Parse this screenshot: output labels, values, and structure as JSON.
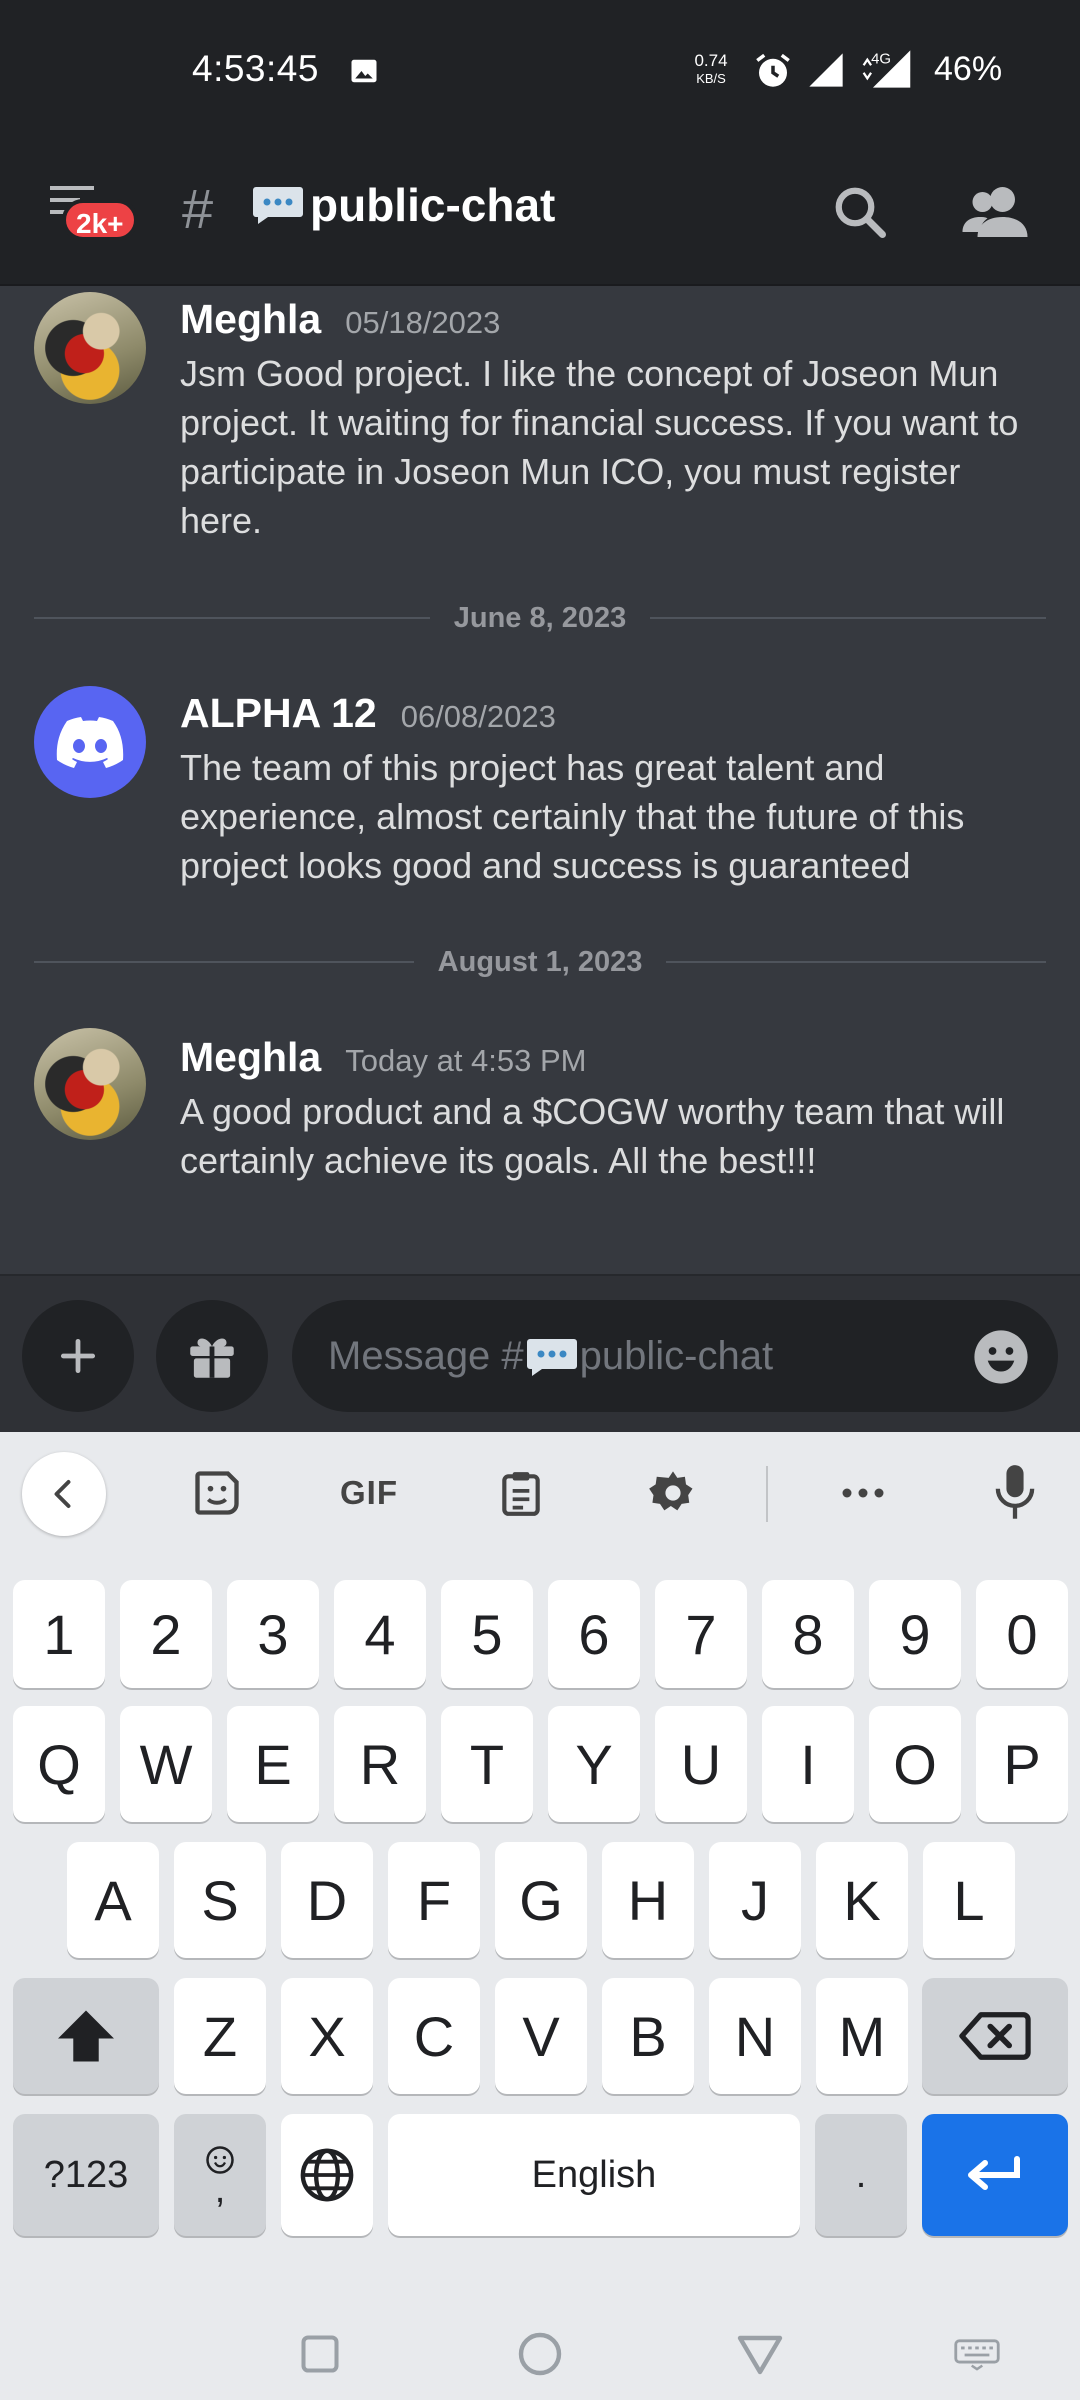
{
  "status_bar": {
    "time": "4:53:45",
    "net_speed": "0.74",
    "net_unit": "KB/S",
    "network_type": "4G",
    "battery": "46%"
  },
  "header": {
    "badge": "2k+",
    "hash": "#",
    "channel_name": "public-chat",
    "icons": [
      "menu-icon",
      "hash-icon",
      "speech-bubble-icon",
      "search-icon",
      "members-icon"
    ]
  },
  "messages": [
    {
      "author": "Meghla",
      "time": "05/18/2023",
      "text": "Jsm Good project. I like the concept of Joseon Mun project. It waiting for financial success. If you want to participate in Joseon Mun ICO, you must register here."
    },
    {
      "divider": "June 8, 2023"
    },
    {
      "author": "ALPHA 12",
      "time": "06/08/2023",
      "text": "The team of this project has great talent and experience, almost certainly that the future of this project looks good and success is guaranteed"
    },
    {
      "divider": "August 1, 2023"
    },
    {
      "author": "Meghla",
      "time": "Today at 4:53 PM",
      "text": "A good product and a $COGW worthy team that will certainly achieve its goals. All the best!!!"
    }
  ],
  "composer": {
    "placeholder_prefix": "Message #",
    "placeholder_channel": "public-chat"
  },
  "keyboard": {
    "toolbar": {
      "gif": "GIF",
      "icons": [
        "back-chevron-icon",
        "sticker-icon",
        "gif-icon",
        "clipboard-icon",
        "settings-icon",
        "more-icon",
        "mic-icon"
      ]
    },
    "row_numbers": [
      "1",
      "2",
      "3",
      "4",
      "5",
      "6",
      "7",
      "8",
      "9",
      "0"
    ],
    "row_q": [
      "Q",
      "W",
      "E",
      "R",
      "T",
      "Y",
      "U",
      "I",
      "O",
      "P"
    ],
    "row_a": [
      "A",
      "S",
      "D",
      "F",
      "G",
      "H",
      "J",
      "K",
      "L"
    ],
    "row_z": [
      "Z",
      "X",
      "C",
      "V",
      "B",
      "N",
      "M"
    ],
    "symbols_key": "?123",
    "comma": ",",
    "space": "English",
    "period": "."
  },
  "colors": {
    "discord_blurple": "#5865f2",
    "badge_red": "#ed4245",
    "enter_blue": "#1a73e8",
    "chat_bg": "#36393f",
    "header_bg": "#202225"
  }
}
